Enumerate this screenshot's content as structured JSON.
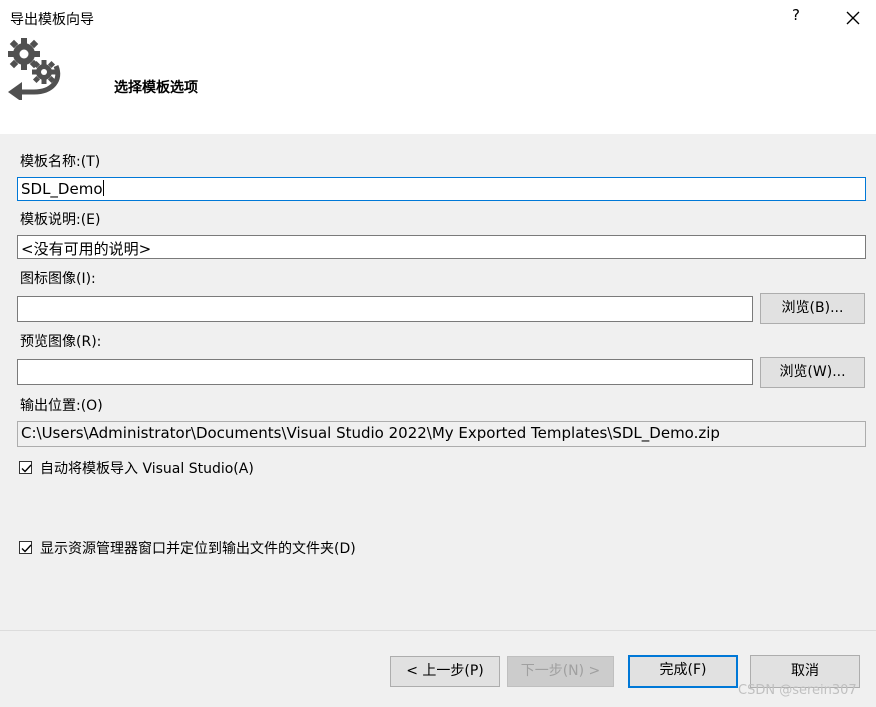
{
  "window": {
    "title": "导出模板向导",
    "help": "?",
    "subtitle": "选择模板选项"
  },
  "form": {
    "template_name_label": "模板名称:(T)",
    "template_name_value": "SDL_Demo",
    "template_desc_label": "模板说明:(E)",
    "template_desc_value": "<没有可用的说明>",
    "icon_image_label": "图标图像(I):",
    "icon_image_value": "",
    "icon_browse": "浏览(B)...",
    "preview_image_label": "预览图像(R):",
    "preview_image_value": "",
    "preview_browse": "浏览(W)...",
    "output_location_label": "输出位置:(O)",
    "output_location_value": "C:\\Users\\Administrator\\Documents\\Visual Studio 2022\\My Exported Templates\\SDL_Demo.zip",
    "auto_import_label": "自动将模板导入 Visual Studio(A)",
    "auto_import_checked": true,
    "show_explorer_label": "显示资源管理器窗口并定位到输出文件的文件夹(D)",
    "show_explorer_checked": true
  },
  "footer": {
    "back": "< 上一步(P)",
    "next": "下一步(N) >",
    "finish": "完成(F)",
    "cancel": "取消"
  },
  "watermark": "CSDN @serein307",
  "icons": {
    "logo": "gear-export-icon",
    "close": "close-icon",
    "check": "check-icon"
  },
  "colors": {
    "focus": "#0078d7",
    "background": "#f0f0f0"
  }
}
